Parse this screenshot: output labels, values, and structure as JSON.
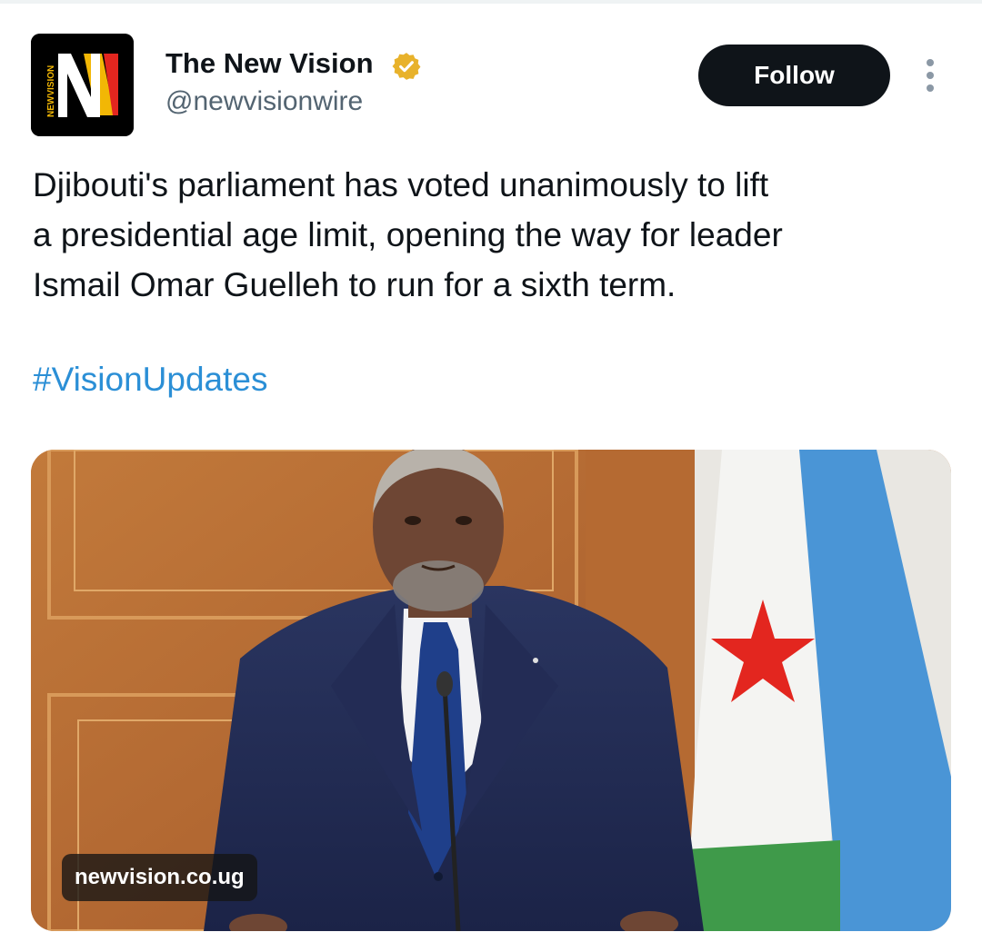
{
  "author": {
    "name": "The New Vision",
    "handle": "@newvisionwire",
    "verified": true,
    "verified_color": "#e8b22b",
    "logo_text_small": "NEWVISION",
    "logo_letter": "N"
  },
  "actions": {
    "follow_label": "Follow",
    "more_icon": "more-horizontal-icon"
  },
  "tweet": {
    "lines": [
      "Djibouti's parliament has voted unanimously to lift",
      "a presidential age limit, opening the way for leader",
      "Ismail Omar Guelleh to run for a sixth term."
    ],
    "hashtag": "#VisionUpdates"
  },
  "media": {
    "source_label": "newvision.co.ug"
  },
  "colors": {
    "text": "#0f1419",
    "secondary": "#536471",
    "link": "#2b8fd6",
    "button_bg": "#0f1419"
  }
}
